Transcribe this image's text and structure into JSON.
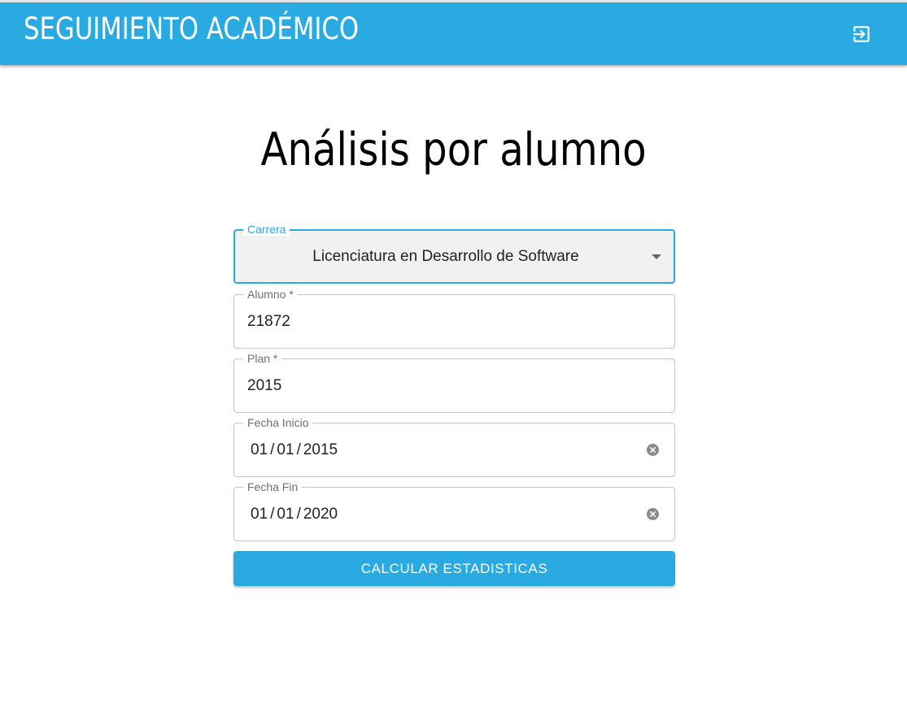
{
  "header": {
    "title": "SEGUIMIENTO ACADÉMICO",
    "logout_icon": "logout-icon",
    "color": "#29abe2"
  },
  "main": {
    "title": "Análisis por alumno"
  },
  "form": {
    "carrera": {
      "label": "Carrera",
      "value": "Licenciatura en Desarrollo de Software"
    },
    "alumno": {
      "label": "Alumno *",
      "value": "21872"
    },
    "plan": {
      "label": "Plan *",
      "value": "2015"
    },
    "fecha_inicio": {
      "label": "Fecha Inicio",
      "day": "01",
      "month": "01",
      "year": "2015"
    },
    "fecha_fin": {
      "label": "Fecha Fin",
      "day": "01",
      "month": "01",
      "year": "2020"
    },
    "submit_label": "CALCULAR ESTADISTICAS"
  }
}
